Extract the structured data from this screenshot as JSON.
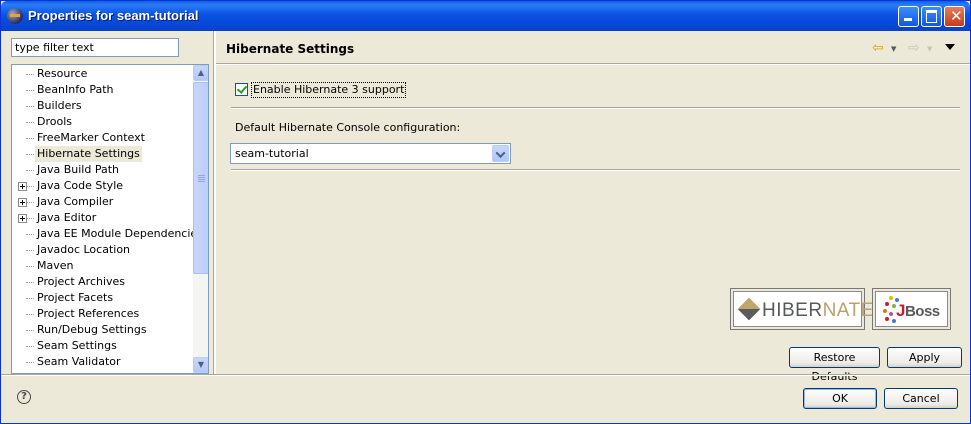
{
  "window": {
    "title": "Properties for seam-tutorial"
  },
  "filter": {
    "placeholder": "type filter text",
    "value": "type filter text"
  },
  "tree": {
    "items": [
      {
        "label": "Resource",
        "expandable": false,
        "selected": false
      },
      {
        "label": "BeanInfo Path",
        "expandable": false,
        "selected": false
      },
      {
        "label": "Builders",
        "expandable": false,
        "selected": false
      },
      {
        "label": "Drools",
        "expandable": false,
        "selected": false
      },
      {
        "label": "FreeMarker Context",
        "expandable": false,
        "selected": false
      },
      {
        "label": "Hibernate Settings",
        "expandable": false,
        "selected": true
      },
      {
        "label": "Java Build Path",
        "expandable": false,
        "selected": false
      },
      {
        "label": "Java Code Style",
        "expandable": true,
        "selected": false
      },
      {
        "label": "Java Compiler",
        "expandable": true,
        "selected": false
      },
      {
        "label": "Java Editor",
        "expandable": true,
        "selected": false
      },
      {
        "label": "Java EE Module Dependencies",
        "expandable": false,
        "selected": false
      },
      {
        "label": "Javadoc Location",
        "expandable": false,
        "selected": false
      },
      {
        "label": "Maven",
        "expandable": false,
        "selected": false
      },
      {
        "label": "Project Archives",
        "expandable": false,
        "selected": false
      },
      {
        "label": "Project Facets",
        "expandable": false,
        "selected": false
      },
      {
        "label": "Project References",
        "expandable": false,
        "selected": false
      },
      {
        "label": "Run/Debug Settings",
        "expandable": false,
        "selected": false
      },
      {
        "label": "Seam Settings",
        "expandable": false,
        "selected": false
      },
      {
        "label": "Seam Validator",
        "expandable": false,
        "selected": false
      }
    ]
  },
  "page": {
    "title": "Hibernate Settings",
    "enable_label": "Enable Hibernate 3 support",
    "enable_checked": true,
    "console_label": "Default Hibernate Console configuration:",
    "console_value": "seam-tutorial"
  },
  "logos": {
    "hibernate_a": "HIBER",
    "hibernate_b": "NATE",
    "jboss_a": "J",
    "jboss_b": "Boss"
  },
  "buttons": {
    "restore_defaults": "Restore Defaults",
    "apply": "Apply",
    "ok": "OK",
    "cancel": "Cancel",
    "help": "?"
  },
  "icons": {
    "window": "eclipse-icon",
    "back": "back-arrow-icon",
    "forward": "forward-arrow-icon",
    "view_menu": "view-menu-icon",
    "help": "help-icon"
  },
  "colors": {
    "titlebar": "#0a54e3",
    "dialog": "#ece9d8",
    "hibernate_gold": "#b6a46c",
    "jboss_red": "#c8202c"
  }
}
